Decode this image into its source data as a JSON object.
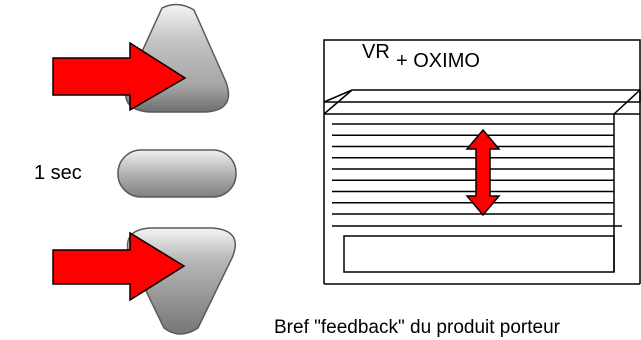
{
  "controls": {
    "up_button": {
      "icon": "triangle-up-button"
    },
    "stop_button": {
      "icon": "pill-stop-button"
    },
    "down_button": {
      "icon": "triangle-down-button"
    },
    "press_duration": "1 sec"
  },
  "shutter": {
    "label": "VR",
    "product": "+ OXIMO",
    "slat_count": 9,
    "motion_icon": "double-arrow-vertical"
  },
  "caption": "Bref \"feedback\" du produit porteur",
  "colors": {
    "arrow_fill": "#ff0000",
    "arrow_stroke": "#000000",
    "button_fill": "#a9a9a9",
    "button_highlight": "#f2f2f2",
    "button_shadow": "#6e6e6e",
    "line": "#000000"
  }
}
